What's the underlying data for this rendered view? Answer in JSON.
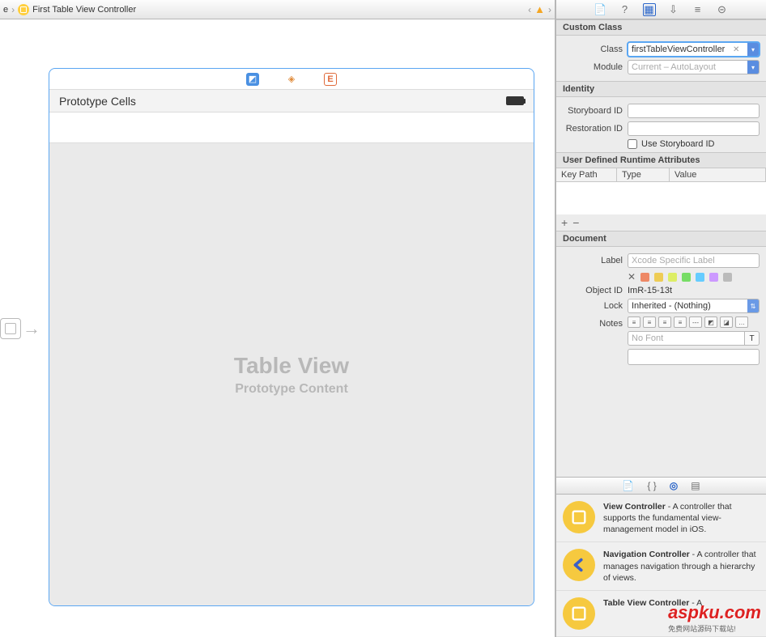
{
  "breadcrumb": {
    "prefix": "e",
    "title": "First Table View Controller"
  },
  "scene": {
    "proto_header": "Prototype Cells",
    "tv_title": "Table View",
    "tv_sub": "Prototype Content"
  },
  "inspector": {
    "custom_class": {
      "header": "Custom Class",
      "class_label": "Class",
      "class_value": "firstTableViewController",
      "module_label": "Module",
      "module_placeholder": "Current – AutoLayout"
    },
    "identity": {
      "header": "Identity",
      "storyboard_label": "Storyboard ID",
      "restoration_label": "Restoration ID",
      "use_sb_label": "Use Storyboard ID"
    },
    "runtime_attrs": {
      "header": "User Defined Runtime Attributes",
      "col_key": "Key Path",
      "col_type": "Type",
      "col_value": "Value"
    },
    "document": {
      "header": "Document",
      "label_label": "Label",
      "label_placeholder": "Xcode Specific Label",
      "swatches": [
        "#e86",
        "#ec5",
        "#de6",
        "#7d6",
        "#6cf",
        "#c9f",
        "#bbb"
      ],
      "objectid_label": "Object ID",
      "objectid_value": "ImR-15-13t",
      "lock_label": "Lock",
      "lock_value": "Inherited - (Nothing)",
      "notes_label": "Notes",
      "font_placeholder": "No Font"
    }
  },
  "library": [
    {
      "name": "View Controller",
      "desc": "A controller that supports the fundamental view-management model in iOS.",
      "icon": "square"
    },
    {
      "name": "Navigation Controller",
      "desc": "A controller that manages navigation through a hierarchy of views.",
      "icon": "back"
    },
    {
      "name": "Table View Controller",
      "desc": "A",
      "icon": "square"
    }
  ],
  "watermark": {
    "text": "aspku.com",
    "sub": "免费网站源码下载站!"
  }
}
